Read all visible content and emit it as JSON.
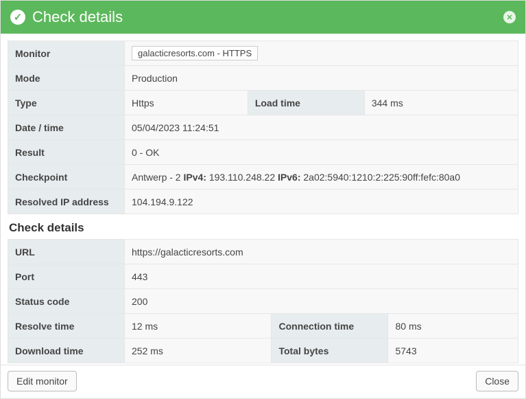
{
  "header": {
    "title": "Check details",
    "icon": "check"
  },
  "summary": {
    "monitor_label": "Monitor",
    "monitor_value": "galacticresorts.com - HTTPS",
    "mode_label": "Mode",
    "mode_value": "Production",
    "type_label": "Type",
    "type_value": "Https",
    "loadtime_label": "Load time",
    "loadtime_value": "344 ms",
    "datetime_label": "Date / time",
    "datetime_value": "05/04/2023 11:24:51",
    "result_label": "Result",
    "result_value": "0 - OK",
    "checkpoint_label": "Checkpoint",
    "checkpoint_text": "Antwerp - 2 ",
    "checkpoint_ipv4_label": "IPv4:",
    "checkpoint_ipv4": " 193.110.248.22 ",
    "checkpoint_ipv6_label": "IPv6:",
    "checkpoint_ipv6": " 2a02:5940:1210:2:225:90ff:fefc:80a0",
    "resolvedip_label": "Resolved IP address",
    "resolvedip_value": "104.194.9.122"
  },
  "details_title": "Check details",
  "details": {
    "url_label": "URL",
    "url_value": "https://galacticresorts.com",
    "port_label": "Port",
    "port_value": "443",
    "status_label": "Status code",
    "status_value": "200",
    "resolve_label": "Resolve time",
    "resolve_value": "12 ms",
    "conn_label": "Connection time",
    "conn_value": "80 ms",
    "download_label": "Download time",
    "download_value": "252 ms",
    "bytes_label": "Total bytes",
    "bytes_value": "5743"
  },
  "footer": {
    "edit": "Edit monitor",
    "close": "Close"
  }
}
